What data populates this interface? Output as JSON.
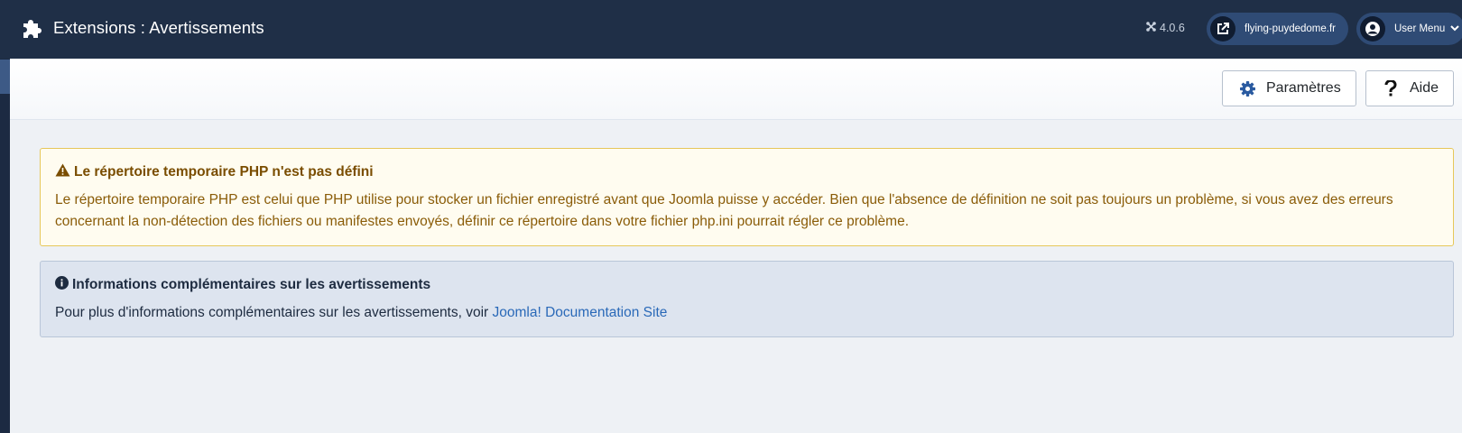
{
  "header": {
    "title": "Extensions : Avertissements",
    "version": "4.0.6",
    "site_link": "flying-puydedome.fr",
    "user_menu": "User Menu"
  },
  "toolbar": {
    "options_label": "Paramètres",
    "help_label": "Aide"
  },
  "warning": {
    "title": "Le répertoire temporaire PHP n'est pas défini",
    "text": "Le répertoire temporaire PHP est celui que PHP utilise pour stocker un fichier enregistré avant que Joomla puisse y accéder. Bien que l'absence de définition ne soit pas toujours un problème, si vous avez des erreurs concernant la non-détection des fichiers ou manifestes envoyés, définir ce répertoire dans votre fichier php.ini pourrait régler ce problème."
  },
  "info": {
    "title": "Informations complémentaires sur les avertissements",
    "text": "Pour plus d'informations complémentaires sur les avertissements, voir",
    "link_text": "Joomla! Documentation Site"
  },
  "colors": {
    "header_bg": "#1f2f47",
    "warning_bg": "#fffcf0",
    "warning_text": "#8a5c08",
    "info_bg": "#dde4ef",
    "link": "#2a69b8"
  },
  "icons": {
    "header": "puzzle-icon",
    "version": "joomla-icon",
    "site": "external-link-icon",
    "user": "user-icon",
    "options": "gear-icon",
    "help": "question-icon",
    "warning": "warning-triangle-icon",
    "info": "info-circle-icon"
  }
}
